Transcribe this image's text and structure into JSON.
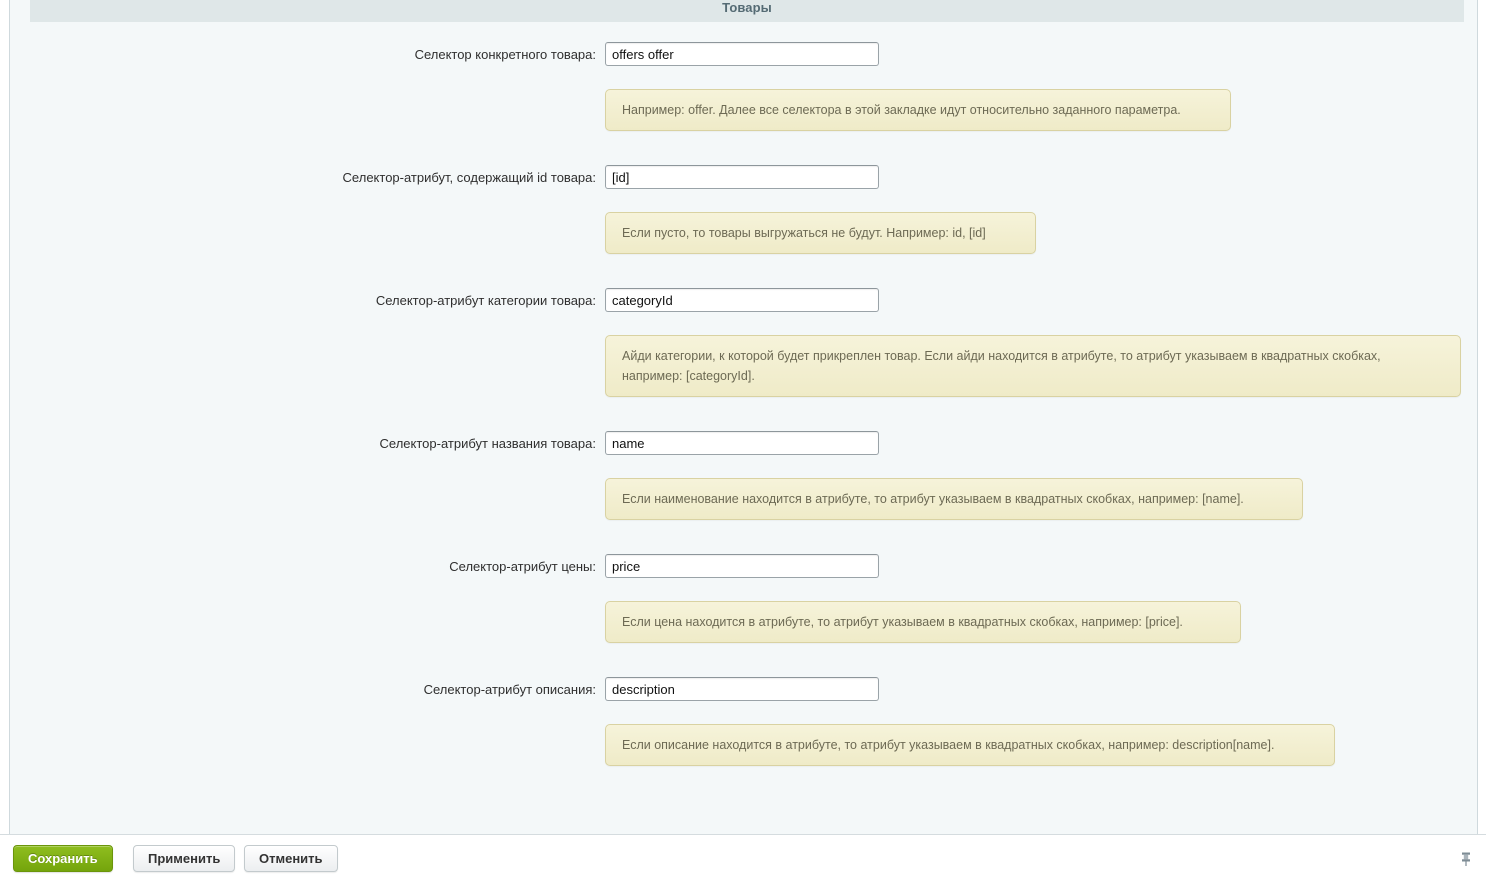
{
  "section": {
    "title": "Товары"
  },
  "fields": [
    {
      "label": "Селектор конкретного товара:",
      "value": "offers offer",
      "name": "product-selector",
      "hint": "Например: offer. Далее все селектора в этой закладке идут относительно заданного параметра.",
      "hint_width": 626,
      "hint_lines": 1
    },
    {
      "label": "Селектор-атрибут, содержащий id товара:",
      "value": "[id]",
      "name": "product-id-selector",
      "hint": "Если пусто, то товары выгружаться не будут. Например: id, [id]",
      "hint_width": 431,
      "hint_lines": 1
    },
    {
      "label": "Селектор-атрибут категории товара:",
      "value": "categoryId",
      "name": "product-category-selector",
      "hint": "Айди категории, к которой будет прикреплен товар. Если айди находится в атрибуте, то атрибут указываем в квадратных скобках, например: [categoryId].",
      "hint_width": 856,
      "hint_lines": 2
    },
    {
      "label": "Селектор-атрибут названия товара:",
      "value": "name",
      "name": "product-name-selector",
      "hint": "Если наименование находится в атрибуте, то атрибут указываем в квадратных скобках, например: [name].",
      "hint_width": 698,
      "hint_lines": 1
    },
    {
      "label": "Селектор-атрибут цены:",
      "value": "price",
      "name": "product-price-selector",
      "hint": "Если цена находится в атрибуте, то атрибут указываем в квадратных скобках, например: [price].",
      "hint_width": 636,
      "hint_lines": 1
    },
    {
      "label": "Селектор-атрибут описания:",
      "value": "description",
      "name": "product-description-selector",
      "hint": "Если описание находится в атрибуте, то атрибут указываем в квадратных скобках, например: description[name].",
      "hint_width": 730,
      "hint_lines": 1
    }
  ],
  "toolbar": {
    "save_label": "Сохранить",
    "apply_label": "Применить",
    "cancel_label": "Отменить",
    "pin_icon": "pushpin-icon"
  },
  "colors": {
    "page_background": "#f4f8f9",
    "header_band": "#dfe7e8",
    "hint_background": "#f2efd2",
    "hint_border": "#d9d2a2",
    "primary_button": "#7fae16"
  }
}
